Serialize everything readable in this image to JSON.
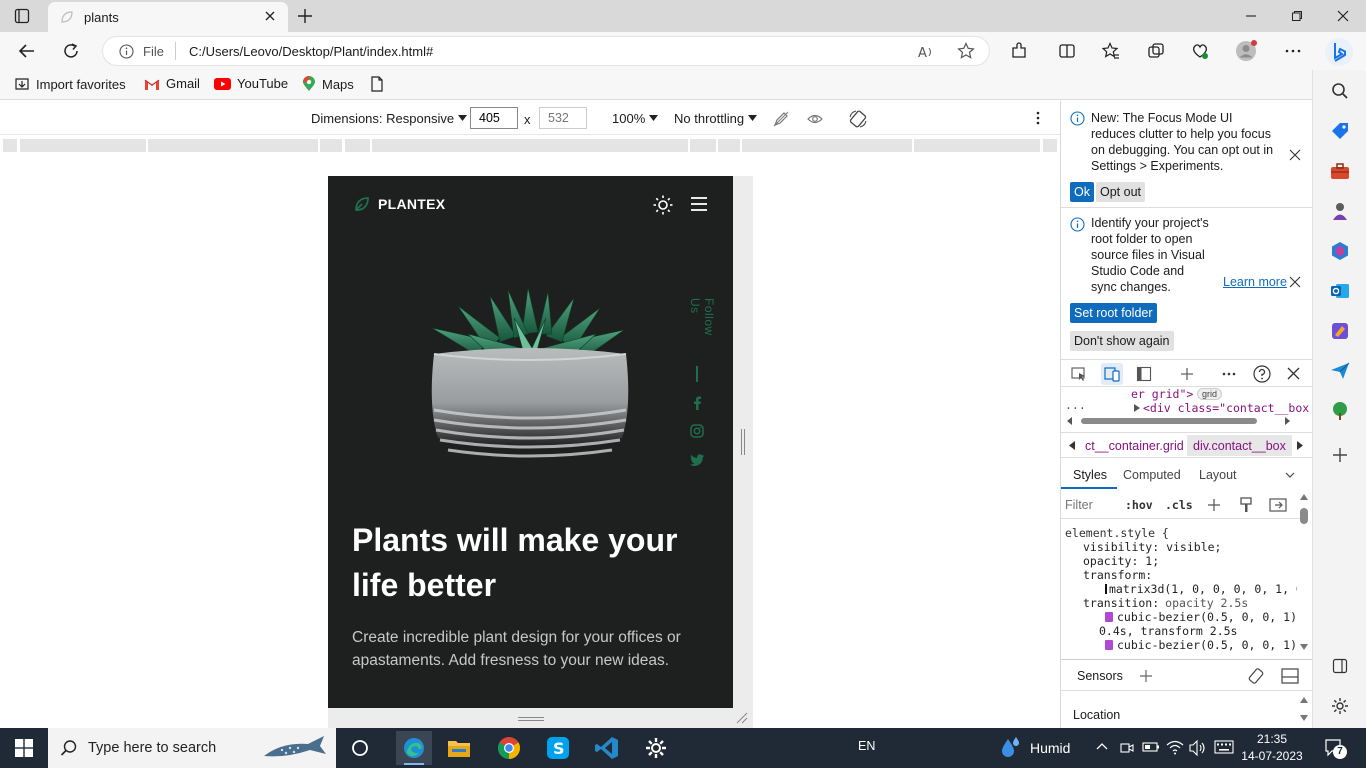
{
  "browser": {
    "tab_title": "plants",
    "url_scheme": "File",
    "url": "C:/Users/Leovo/Desktop/Plant/index.html#",
    "bookmarks": [
      {
        "label": "Import favorites",
        "icon": "import-icon"
      },
      {
        "label": "Gmail",
        "icon": "gmail-icon"
      },
      {
        "label": "YouTube",
        "icon": "youtube-icon"
      },
      {
        "label": "Maps",
        "icon": "maps-icon"
      }
    ]
  },
  "device_toolbar": {
    "dimensions_label": "Dimensions: Responsive",
    "width": "405",
    "times": "x",
    "height": "532",
    "zoom": "100%",
    "throttling": "No throttling"
  },
  "site": {
    "brand": "PLANTEX",
    "hero_title": "Plants will make your life better",
    "hero_description": "Create incredible plant design for your offices or apastaments. Add fresness to your new ideas.",
    "follow_label": "Follow Us",
    "accent_color": "#1f6f4e",
    "background_color": "#1e1f1f"
  },
  "devtools": {
    "focus_notice": "New: The Focus Mode UI reduces clutter to help you focus on debugging. You can opt out in Settings > Experiments.",
    "ok_label": "Ok",
    "optout_label": "Opt out",
    "root_notice": "Identify your project's root folder to open source files in Visual Studio Code and sync changes.",
    "learn_more": "Learn more",
    "set_root_label": "Set root folder",
    "dont_show_label": "Don't show again",
    "dom_line1": "er grid\">",
    "dom_badge": "grid",
    "dom_line2": "<div class=\"contact__box",
    "breadcrumb_1": "ct__container.grid",
    "breadcrumb_2": "div.contact__box",
    "styles_tabs": [
      "Styles",
      "Computed",
      "Layout"
    ],
    "filter_placeholder": "Filter",
    "hov": ":hov",
    "cls": ".cls",
    "css_lines": [
      "element.style {",
      "visibility: visible;",
      "opacity: 1;",
      "transform:",
      "matrix3d(1, 0, 0, 0, 0, 1, 0",
      "transition:",
      "opacity 2.5s",
      "cubic-bezier(0.5, 0, 0, 1)",
      "0.4s, transform 2.5s",
      "cubic-bezier(0.5, 0, 0, 1)"
    ],
    "sensors_tab": "Sensors",
    "location_label": "Location"
  },
  "taskbar": {
    "search_placeholder": "Type here to search",
    "language": "EN",
    "weather": "Humid",
    "time": "21:35",
    "date": "14-07-2023",
    "notification_count": "7"
  }
}
